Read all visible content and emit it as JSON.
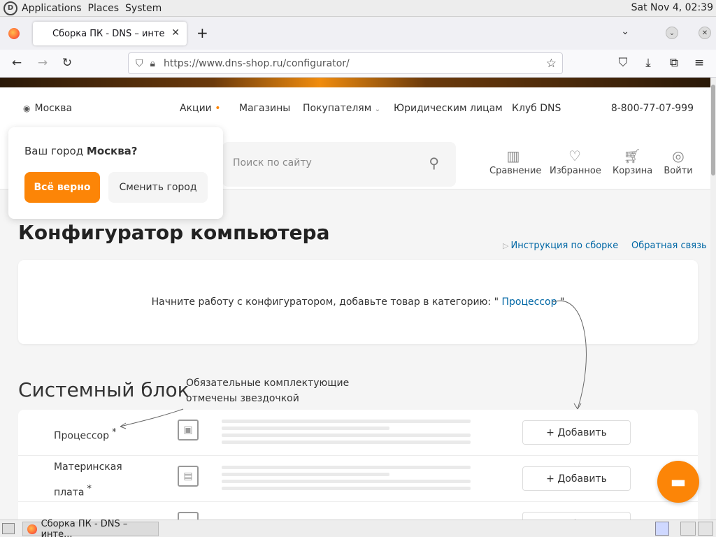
{
  "system_bar": {
    "menus": [
      "Applications",
      "Places",
      "System"
    ],
    "clock": "Sat Nov  4, 02:39"
  },
  "browser": {
    "tab_title": "Сборка ПК - DNS – интерн",
    "url": "https://www.dns-shop.ru/configurator/"
  },
  "header": {
    "city": "Москва",
    "nav": [
      {
        "label": "Акции"
      },
      {
        "label": "Магазины"
      },
      {
        "label": "Покупателям"
      },
      {
        "label": "Юридическим лицам"
      },
      {
        "label": "Клуб DNS"
      }
    ],
    "phone": "8-800-77-07-999",
    "search_placeholder": "Поиск по сайту",
    "icons": [
      {
        "label": "Сравнение",
        "icon": "chart-icon"
      },
      {
        "label": "Избранное",
        "icon": "heart-icon"
      },
      {
        "label": "Корзина",
        "icon": "cart-icon"
      },
      {
        "label": "Войти",
        "icon": "user-icon"
      }
    ]
  },
  "city_popup": {
    "question": "Ваш город",
    "city": "Москва?",
    "confirm": "Всё верно",
    "change": "Сменить город"
  },
  "main": {
    "title": "Конфигуратор компьютера",
    "instructions_link": "Инструкция по сборке",
    "feedback_link": "Обратная связь",
    "start_msg_before": "Начните работу с конфигуратором, добавьте товар в категорию: \"",
    "start_msg_link": "Процессор",
    "start_msg_after": "\"",
    "section_title": "Системный блок",
    "hint_line1": "Обязательные комплектующие",
    "hint_line2": "отмечены звездочкой",
    "add_label": "+ Добавить",
    "rows": [
      {
        "name": "Процессор",
        "icon": "cpu-icon"
      },
      {
        "name_line1": "Материнская",
        "name_line2": "плата",
        "icon": "motherboard-icon"
      },
      {
        "icon": "case-icon"
      }
    ]
  },
  "taskbar": {
    "window_title": "Сборка ПК - DNS – инте..."
  },
  "colors": {
    "accent": "#fc8507",
    "link": "#0067a5"
  }
}
